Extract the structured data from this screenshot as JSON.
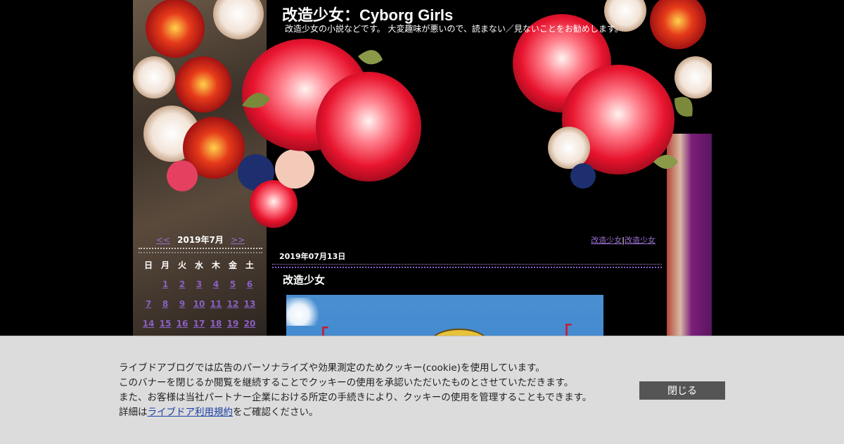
{
  "header": {
    "title": "改造少女：Cyborg Girls",
    "description": "改造少女の小説などです。 大変趣味が悪いので、読まない／見ないことをお勧めします。"
  },
  "calendar": {
    "prev_label": "<<",
    "month_label": "2019年7月",
    "next_label": ">>",
    "weekdays": [
      "日",
      "月",
      "火",
      "水",
      "木",
      "金",
      "土"
    ],
    "first_weekday_index": 1,
    "days_shown": [
      1,
      2,
      3,
      4,
      5,
      6,
      7,
      8,
      9,
      10,
      11,
      12,
      13,
      14,
      15,
      16,
      17,
      18,
      19,
      20
    ]
  },
  "main": {
    "category_links": [
      "改造少女",
      "改造少女"
    ],
    "category_separator": "|",
    "post": {
      "date": "2019年07月13日",
      "title": "改造少女",
      "image_brackets": [
        "「",
        "「"
      ]
    }
  },
  "cookie_banner": {
    "line1": "ライブドアブログでは広告のパーソナライズや効果測定のためクッキー(cookie)を使用しています。",
    "line2": "このバナーを閉じるか閲覧を継続することでクッキーの使用を承認いただいたものとさせていただきます。",
    "line3": "また、お客様は当社パートナー企業における所定の手続きにより、クッキーの使用を管理することもできます。",
    "line4_prefix": "詳細は",
    "line4_link": "ライブドア利用規約",
    "line4_suffix": "をご確認ください。",
    "close_label": "閉じる"
  },
  "colors": {
    "background": "#000000",
    "link_purple": "#8a60c4",
    "banner_bg": "#dcdcdc",
    "close_button": "#555555"
  }
}
